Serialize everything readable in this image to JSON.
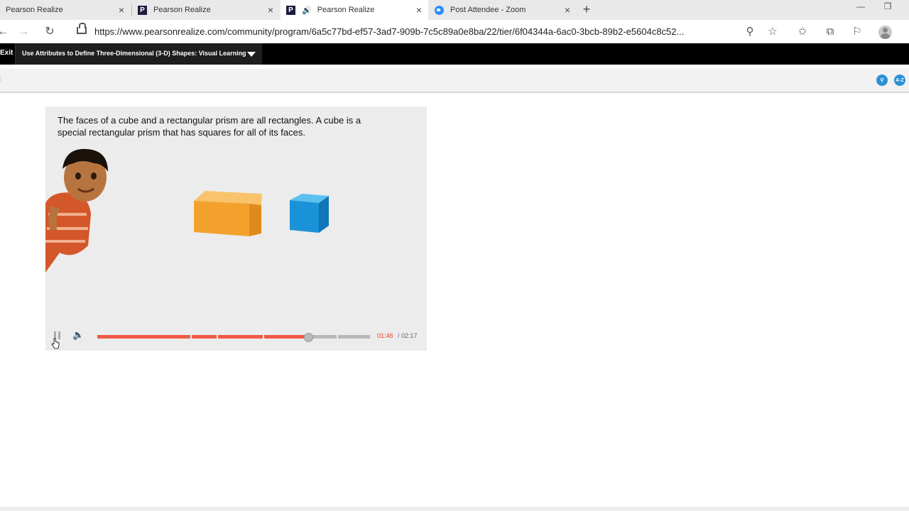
{
  "browser": {
    "tabs": [
      {
        "label": "Pearson Realize",
        "icon": "none"
      },
      {
        "label": "Pearson Realize",
        "icon": "pearson-p"
      },
      {
        "label": "Pearson Realize",
        "icon": "pearson-p",
        "audio": true
      },
      {
        "label": "Post Attendee - Zoom",
        "icon": "zoom"
      }
    ],
    "url": "https://www.pearsonrealize.com/community/program/6a5c77bd-ef57-3ad7-909b-7c5c89a0e8ba/22/tier/6f04344a-6ac0-3bcb-89b2-e5604c8c52..."
  },
  "lesson_bar": {
    "exit_label": "Exit",
    "title": "Use Attributes to Define Three-Dimensional (3-D) Shapes: Visual Learning"
  },
  "toolbar": {
    "tool_az_label": "A-Z"
  },
  "video": {
    "caption": "The faces of a cube and a rectangular prism are all rectangles. A cube is a special rectangular prism that has squares for all of its faces.",
    "current_time": "01:46",
    "total_time": "/ 02:17",
    "progress_fraction": 0.774,
    "colors": {
      "prism": "#f3a12d",
      "cube": "#1a92d8",
      "progress": "#ef5a45"
    }
  }
}
